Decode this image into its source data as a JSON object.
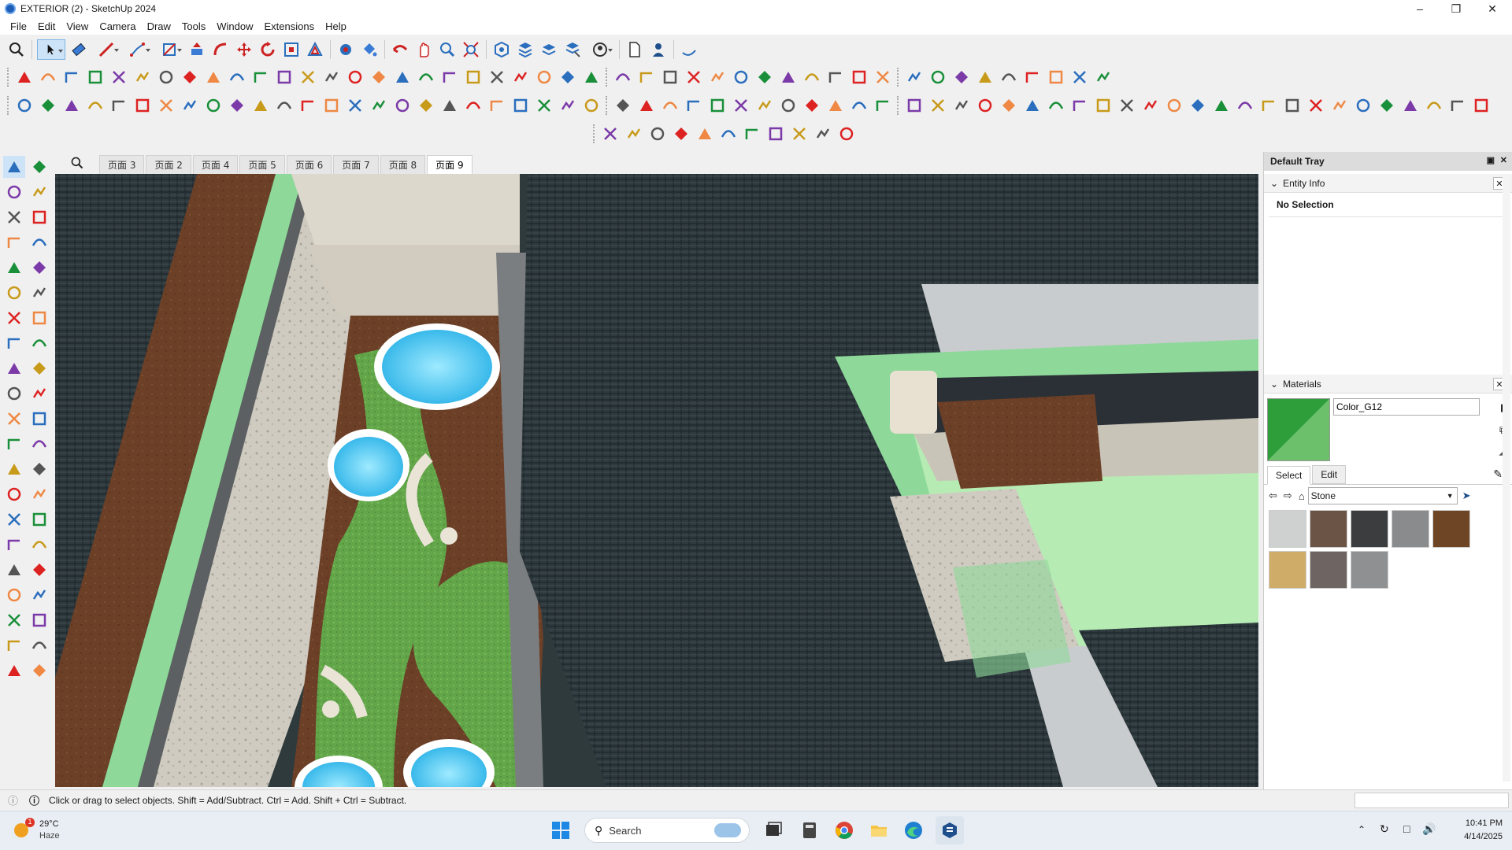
{
  "window": {
    "title": "EXTERIOR  (2) - SketchUp 2024"
  },
  "menu": [
    "File",
    "Edit",
    "View",
    "Camera",
    "Draw",
    "Tools",
    "Window",
    "Extensions",
    "Help"
  ],
  "scene_tabs": [
    "页面 3",
    "页面 2",
    "页面 4",
    "页面 5",
    "页面 6",
    "页面 7",
    "页面 8",
    "页面 9"
  ],
  "active_tab_index": 7,
  "tray": {
    "title": "Default Tray",
    "entity_info": {
      "header": "Entity Info",
      "selection": "No Selection"
    },
    "materials": {
      "header": "Materials",
      "current_material": "Color_G12",
      "current_color": "#2e9e3b",
      "tab_select": "Select",
      "tab_edit": "Edit",
      "library": "Stone",
      "swatch_colors": [
        "#cfd0d0",
        "#6b5445",
        "#3c3d3e",
        "#8a8b8c",
        "#6e4626",
        "#cfac68",
        "#6e6563",
        "#8f9092"
      ]
    }
  },
  "status": {
    "message": "Click or drag to select objects. Shift = Add/Subtract. Ctrl = Add. Shift + Ctrl = Subtract."
  },
  "taskbar": {
    "weather_temp": "29°C",
    "weather_desc": "Haze",
    "weather_badge": "1",
    "search_placeholder": "Search",
    "time": "10:41 PM",
    "date": "4/14/2025"
  },
  "icons": {
    "tool_colors": [
      "#d22",
      "#e84",
      "#2a6ebd",
      "#1a8f3a",
      "#7b3aa8",
      "#c89a1a",
      "#555"
    ]
  }
}
